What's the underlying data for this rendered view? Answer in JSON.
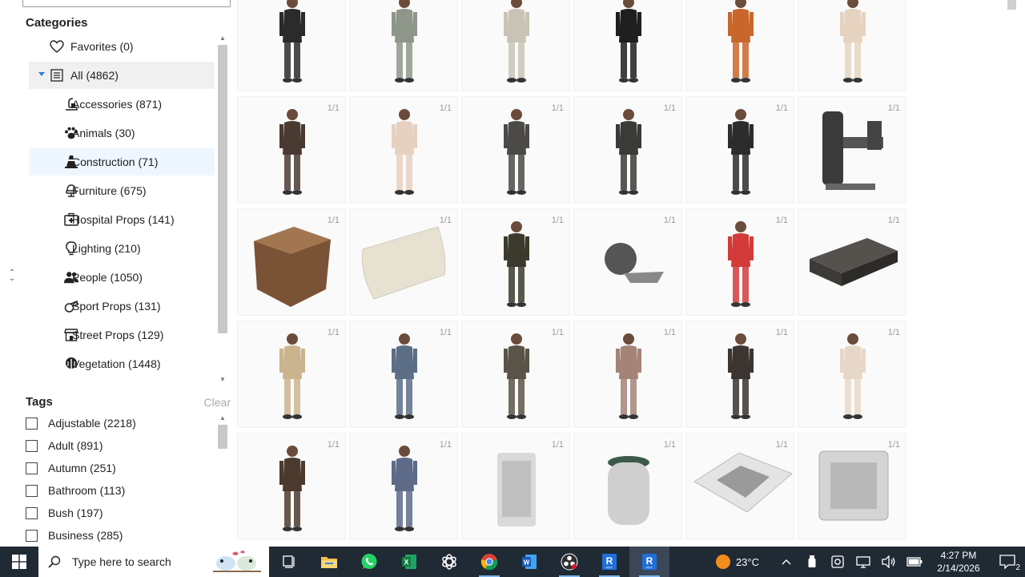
{
  "sidebar": {
    "categories_title": "Categories",
    "categories": [
      {
        "label": "Favorites (0)",
        "icon": "heart-icon"
      },
      {
        "label": "All (4862)",
        "icon": "list-icon"
      },
      {
        "label": "Accessories (871)",
        "icon": "accessory-icon"
      },
      {
        "label": "Animals (30)",
        "icon": "paw-icon"
      },
      {
        "label": "Construction (71)",
        "icon": "traffic-cone-icon"
      },
      {
        "label": "Furniture (675)",
        "icon": "chair-icon"
      },
      {
        "label": "Hospital Props (141)",
        "icon": "first-aid-icon"
      },
      {
        "label": "Lighting (210)",
        "icon": "lightbulb-icon"
      },
      {
        "label": "People (1050)",
        "icon": "people-icon"
      },
      {
        "label": "Sport Props (131)",
        "icon": "whistle-icon"
      },
      {
        "label": "Street Props (129)",
        "icon": "storefront-icon"
      },
      {
        "label": "Vegetation (1448)",
        "icon": "tree-icon"
      }
    ],
    "tags_title": "Tags",
    "tags_clear": "Clear",
    "tags": [
      {
        "label": "Adjustable (2218)"
      },
      {
        "label": "Adult (891)"
      },
      {
        "label": "Autumn (251)"
      },
      {
        "label": "Bathroom (113)"
      },
      {
        "label": "Bush (197)"
      },
      {
        "label": "Business (285)"
      }
    ]
  },
  "gallery": {
    "tiles": [
      {
        "kind": "person",
        "color": "#2b2b2b",
        "count": ""
      },
      {
        "kind": "person",
        "color": "#8d9688",
        "count": ""
      },
      {
        "kind": "person",
        "color": "#c9c3b5",
        "count": ""
      },
      {
        "kind": "person",
        "color": "#1f1f1f",
        "count": ""
      },
      {
        "kind": "person",
        "color": "#c9662c",
        "count": ""
      },
      {
        "kind": "person",
        "color": "#e6d3bf",
        "count": ""
      },
      {
        "kind": "person",
        "color": "#4a3a32",
        "count": "1/1"
      },
      {
        "kind": "person",
        "color": "#e6d0bf",
        "count": "1/1"
      },
      {
        "kind": "person",
        "color": "#4b4a47",
        "count": "1/1"
      },
      {
        "kind": "person",
        "color": "#3a3a36",
        "count": "1/1"
      },
      {
        "kind": "person",
        "color": "#2c2c2c",
        "count": "1/1"
      },
      {
        "kind": "gym-machine",
        "color": "#3a3a3a",
        "count": "1/1"
      },
      {
        "kind": "cube-ottoman",
        "color": "#7a5236",
        "count": "1/1"
      },
      {
        "kind": "cushion",
        "color": "#e7e1d2",
        "count": "1/1"
      },
      {
        "kind": "person",
        "color": "#3b3a2c",
        "count": "1/1"
      },
      {
        "kind": "roller",
        "color": "#555555",
        "count": "1/1"
      },
      {
        "kind": "person",
        "color": "#d33a3a",
        "count": "1/1"
      },
      {
        "kind": "step-platform",
        "color": "#3d3b38",
        "count": "1/1"
      },
      {
        "kind": "person",
        "color": "#c9b48d",
        "count": "1/1"
      },
      {
        "kind": "person",
        "color": "#5c6e86",
        "count": "1/1"
      },
      {
        "kind": "person",
        "color": "#5a5347",
        "count": "1/1"
      },
      {
        "kind": "person",
        "color": "#a58377",
        "count": "1/1"
      },
      {
        "kind": "person",
        "color": "#3b3430",
        "count": "1/1"
      },
      {
        "kind": "person",
        "color": "#e7d7c8",
        "count": "1/1"
      },
      {
        "kind": "person",
        "color": "#4c3a2e",
        "count": "1/1"
      },
      {
        "kind": "person",
        "color": "#5d6a88",
        "count": "1/1"
      },
      {
        "kind": "air-purifier",
        "color": "#d9d9d9",
        "count": "1/1"
      },
      {
        "kind": "round-purifier",
        "color": "#cfcfcf",
        "count": "1/1"
      },
      {
        "kind": "ceiling-vent",
        "color": "#e4e4e4",
        "count": "1/1"
      },
      {
        "kind": "square-panel",
        "color": "#d4d4d4",
        "count": "1/1"
      }
    ]
  },
  "taskbar": {
    "search_placeholder": "Type here to search",
    "apps": [
      {
        "icon": "task-view-icon"
      },
      {
        "icon": "file-explorer-icon"
      },
      {
        "icon": "whatsapp-icon"
      },
      {
        "icon": "excel-icon"
      },
      {
        "icon": "chatgpt-icon"
      },
      {
        "icon": "chrome-icon"
      },
      {
        "icon": "word-icon"
      },
      {
        "icon": "obs-icon"
      },
      {
        "icon": "revit-icon"
      },
      {
        "icon": "revit-icon"
      }
    ],
    "weather": "23°C",
    "time": "4:27 PM",
    "date": "2/14/2026",
    "notification_count": "2",
    "colors": {
      "bar": "#202a35",
      "accent": "#2a7bd6"
    }
  }
}
